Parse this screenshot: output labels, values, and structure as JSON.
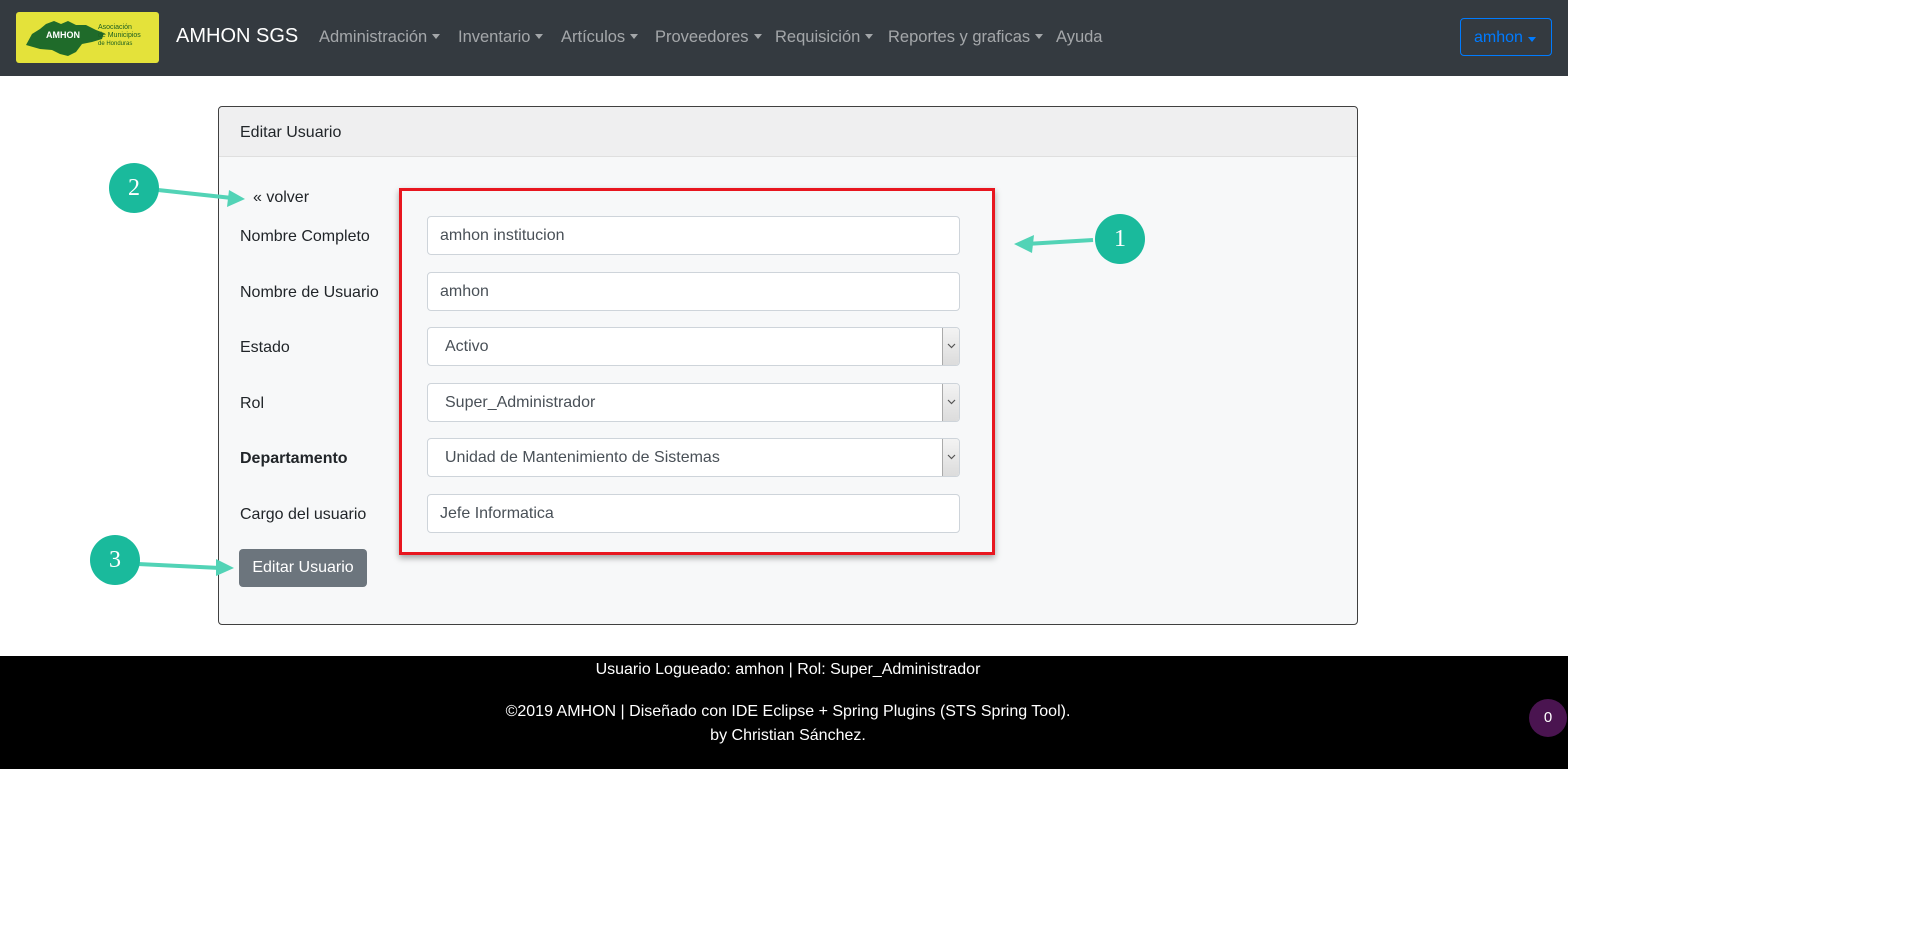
{
  "navbar": {
    "logo": {
      "abbr": "AMHON",
      "line1": "Asociación",
      "line2": "de Municipios",
      "line3": "de Honduras"
    },
    "brand": "AMHON SGS",
    "menu": [
      {
        "label": "Administración"
      },
      {
        "label": "Inventario"
      },
      {
        "label": "Artículos"
      },
      {
        "label": "Proveedores"
      },
      {
        "label": "Requisición"
      },
      {
        "label": "Reportes y graficas"
      },
      {
        "label": "Ayuda"
      }
    ],
    "user_menu": "amhon"
  },
  "card": {
    "title": "Editar Usuario",
    "back_link": "« volver",
    "fields": {
      "full_name": {
        "label": "Nombre Completo",
        "value": "amhon institucion"
      },
      "username": {
        "label": "Nombre de Usuario",
        "value": "amhon"
      },
      "status": {
        "label": "Estado",
        "value": "Activo"
      },
      "role": {
        "label": "Rol",
        "value": "Super_Administrador"
      },
      "department": {
        "label": "Departamento",
        "value": "Unidad de Mantenimiento de Sistemas"
      },
      "position": {
        "label": "Cargo del usuario",
        "value": "Jefe Informatica"
      }
    },
    "submit_label": "Editar Usuario"
  },
  "annotations": {
    "callout_1": "1",
    "callout_2": "2",
    "callout_3": "3",
    "colors": {
      "callout": "#1aba9c",
      "highlight_box": "#e8161f"
    }
  },
  "footer": {
    "logged_user": "Usuario Logueado: amhon | Rol: Super_Administrador",
    "copyright": "©2019 AMHON | Diseñado con IDE Eclipse + Spring Plugins (STS Spring Tool).",
    "author": "by Christian Sánchez."
  },
  "counter_badge": "0"
}
